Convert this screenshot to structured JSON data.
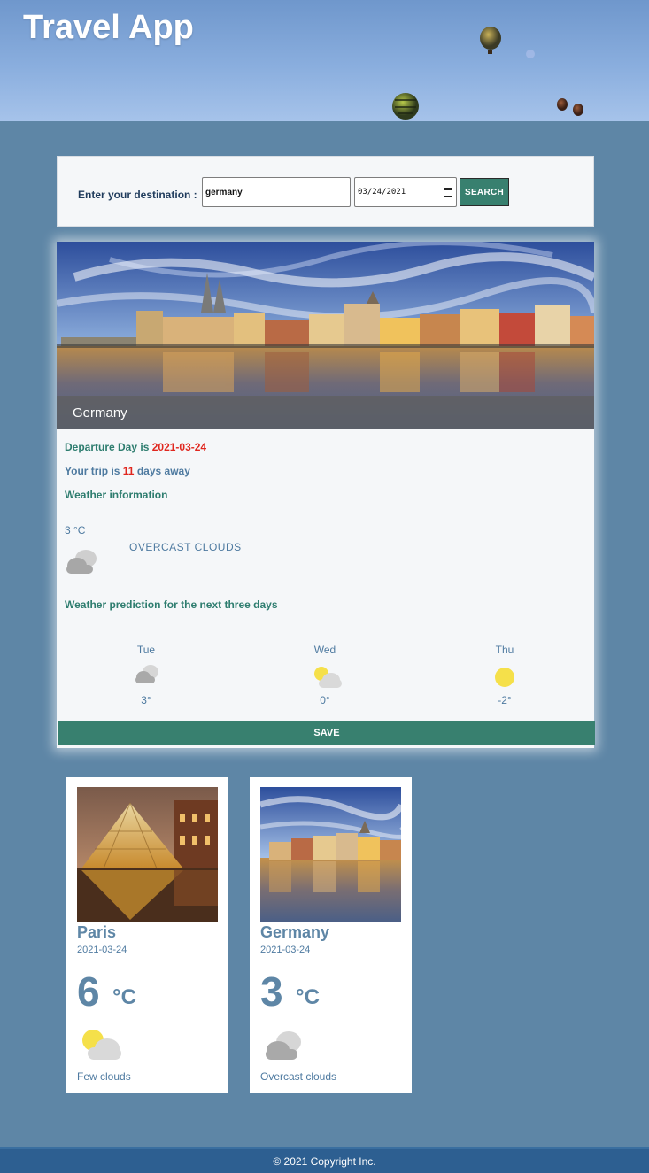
{
  "header": {
    "title": "Travel App"
  },
  "search": {
    "label": "Enter your destination :",
    "destination_value": "germany",
    "date_value": "03/24/2021",
    "button_label": "SEARCH"
  },
  "result": {
    "country": "Germany",
    "departure_prefix": "Departure Day is",
    "departure_date": "2021-03-24",
    "trip_prefix": "Your trip is",
    "days_away": "11",
    "trip_suffix": "days away",
    "weather_heading": "Weather information",
    "current_temp": "3 °C",
    "current_desc": "OVERCAST CLOUDS",
    "forecast_heading": "Weather prediction for the next three days",
    "forecast": [
      {
        "day": "Tue",
        "temp": "3°",
        "icon": "cloud-icon"
      },
      {
        "day": "Wed",
        "temp": "0°",
        "icon": "partly-cloudy-icon"
      },
      {
        "day": "Thu",
        "temp": "-2°",
        "icon": "sun-icon"
      }
    ],
    "save_label": "SAVE"
  },
  "saved_trips": [
    {
      "city": "Paris",
      "date": "2021-03-24",
      "temp": "6",
      "unit": "°C",
      "condition": "Few clouds",
      "icon": "partly-cloudy-icon"
    },
    {
      "city": "Germany",
      "date": "2021-03-24",
      "temp": "3",
      "unit": "°C",
      "condition": "Overcast clouds",
      "icon": "cloud-icon"
    }
  ],
  "footer": {
    "text": "© 2021 Copyright Inc."
  },
  "colors": {
    "accent": "#38806f",
    "background": "#5e86a6",
    "footer": "#2d5f91",
    "highlight": "#e0271f"
  }
}
